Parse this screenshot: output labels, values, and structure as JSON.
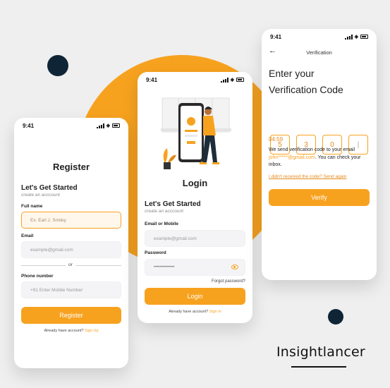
{
  "colors": {
    "accent": "#f7a21f",
    "dark_dot": "#0f2536",
    "background": "#efefef"
  },
  "brand": "Insightlancer",
  "register": {
    "time": "9:41",
    "title": "Register",
    "heading": "Let's Get Started",
    "subheading": "create an  acccount",
    "fullname_label": "Full name",
    "fullname_placeholder": "Ex. Earl J. Smiley",
    "email_label": "Email",
    "email_placeholder": "example@gmail.com",
    "or_text": "or",
    "phone_label": "Phone number",
    "phone_placeholder": "+91 Enter Mobile Number",
    "button": "Register",
    "footer_text": "Already have account?",
    "footer_link": "Sign Up"
  },
  "login": {
    "time": "9:41",
    "title": "Login",
    "heading": "Let's Get Started",
    "subheading": "create an  acccount",
    "email_label": "Email or Mobile",
    "email_placeholder": "example@gmail.com",
    "password_label": "Password",
    "password_value": "••••••••••••••",
    "forgot": "Forgot password?",
    "button": "Login",
    "footer_text": "Already have account?",
    "footer_link": "Sign In"
  },
  "verification": {
    "time": "9:41",
    "nav_title": "Verification",
    "heading_line1": "Enter your",
    "heading_line2": "Verification Code",
    "digits": [
      "5",
      "3",
      "0",
      "|"
    ],
    "timer": "04:59",
    "message_part1": "We send verification code to your email ",
    "message_email": "john*****@gmail.com",
    "message_part2": ". You can check your inbox.",
    "resend": "I didn't received the code? Send again",
    "button": "Verify"
  }
}
